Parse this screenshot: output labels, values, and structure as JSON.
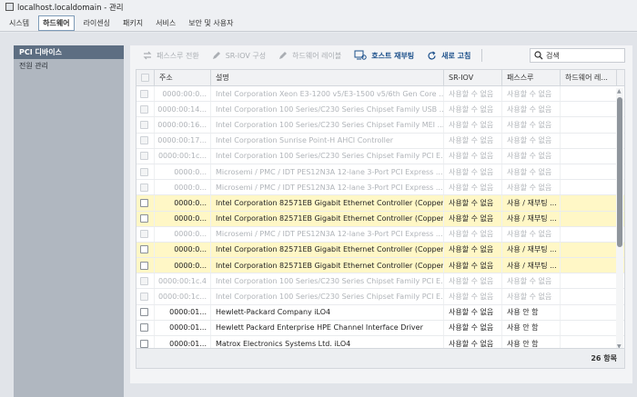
{
  "window": {
    "title": "localhost.localdomain - 관리"
  },
  "tabs": [
    {
      "label": "시스템"
    },
    {
      "label": "하드웨어"
    },
    {
      "label": "라이센싱"
    },
    {
      "label": "패키지"
    },
    {
      "label": "서비스"
    },
    {
      "label": "보안 및 사용자"
    }
  ],
  "active_tab": "하드웨어",
  "sidebar": {
    "items": [
      {
        "label": "PCI 디바이스"
      },
      {
        "label": "전원 관리"
      }
    ]
  },
  "toolbar": {
    "passthrough": "패스스루 전환",
    "sriov": "SR-IOV 구성",
    "hw_label": "하드웨어 레이블",
    "reboot": "호스트 재부팅",
    "refresh": "새로 고침",
    "search_placeholder": "검색"
  },
  "table": {
    "headers": {
      "addr": "주소",
      "desc": "설명",
      "sriov": "SR-IOV",
      "pass": "패스스루",
      "hw": "하드웨어 레..."
    },
    "rows": [
      {
        "state": "disabled",
        "addr": "0000:00:0...",
        "desc": "Intel Corporation Xeon E3-1200 v5/E3-1500 v5/6th Gen Core ...",
        "sriov": "사용할 수 없음",
        "pass": "사용할 수 없음"
      },
      {
        "state": "disabled",
        "addr": "0000:00:14...",
        "desc": "Intel Corporation 100 Series/C230 Series Chipset Family USB ...",
        "sriov": "사용할 수 없음",
        "pass": "사용할 수 없음"
      },
      {
        "state": "disabled",
        "addr": "0000:00:16...",
        "desc": "Intel Corporation 100 Series/C230 Series Chipset Family MEI ...",
        "sriov": "사용할 수 없음",
        "pass": "사용할 수 없음"
      },
      {
        "state": "disabled",
        "addr": "0000:00:17...",
        "desc": "Intel Corporation Sunrise Point-H AHCI Controller",
        "sriov": "사용할 수 없음",
        "pass": "사용할 수 없음"
      },
      {
        "state": "disabled",
        "addr": "0000:00:1c...",
        "desc": "Intel Corporation 100 Series/C230 Series Chipset Family PCI E...",
        "sriov": "사용할 수 없음",
        "pass": "사용할 수 없음"
      },
      {
        "state": "disabled",
        "addr": "0000:0...",
        "desc": "Microsemi / PMC / IDT PES12N3A 12-lane 3-Port PCI Express ...",
        "sriov": "사용할 수 없음",
        "pass": "사용할 수 없음"
      },
      {
        "state": "disabled",
        "addr": "0000:0...",
        "desc": "Microsemi / PMC / IDT PES12N3A 12-lane 3-Port PCI Express ...",
        "sriov": "사용할 수 없음",
        "pass": "사용할 수 없음"
      },
      {
        "state": "selected",
        "addr": "0000:0...",
        "desc": "Intel Corporation 82571EB Gigabit Ethernet Controller (Copper)",
        "sriov": "사용할 수 없음",
        "pass": "사용 / 재부팅 ..."
      },
      {
        "state": "selected",
        "addr": "0000:0...",
        "desc": "Intel Corporation 82571EB Gigabit Ethernet Controller (Copper)",
        "sriov": "사용할 수 없음",
        "pass": "사용 / 재부팅 ..."
      },
      {
        "state": "disabled",
        "addr": "0000:0...",
        "desc": "Microsemi / PMC / IDT PES12N3A 12-lane 3-Port PCI Express ...",
        "sriov": "사용할 수 없음",
        "pass": "사용할 수 없음"
      },
      {
        "state": "selected",
        "addr": "0000:0...",
        "desc": "Intel Corporation 82571EB Gigabit Ethernet Controller (Copper)",
        "sriov": "사용할 수 없음",
        "pass": "사용 / 재부팅 ..."
      },
      {
        "state": "selected",
        "addr": "0000:0...",
        "desc": "Intel Corporation 82571EB Gigabit Ethernet Controller (Copper)",
        "sriov": "사용할 수 없음",
        "pass": "사용 / 재부팅 ..."
      },
      {
        "state": "disabled",
        "addr": "0000:00:1c.4",
        "desc": "Intel Corporation 100 Series/C230 Series Chipset Family PCI E...",
        "sriov": "사용할 수 없음",
        "pass": "사용할 수 없음"
      },
      {
        "state": "disabled",
        "addr": "0000:00:1c...",
        "desc": "Intel Corporation 100 Series/C230 Series Chipset Family PCI E...",
        "sriov": "사용할 수 없음",
        "pass": "사용할 수 없음"
      },
      {
        "state": "normal",
        "addr": "0000:01...",
        "desc": "Hewlett-Packard Company iLO4",
        "sriov": "사용할 수 없음",
        "pass": "사용 안 함"
      },
      {
        "state": "normal",
        "addr": "0000:01...",
        "desc": "Hewlett Packard Enterprise HPE Channel Interface Driver",
        "sriov": "사용할 수 없음",
        "pass": "사용 안 함"
      },
      {
        "state": "normal",
        "addr": "0000:01...",
        "desc": "Matrox Electronics Systems Ltd. iLO4",
        "sriov": "사용할 수 없음",
        "pass": "사용 안 함"
      }
    ],
    "footer_count": "26 항목"
  },
  "colors": {
    "selected_row": "#fff7c6",
    "active_sidebar": "#5d6e82",
    "accent_text": "#1b4f8a"
  }
}
